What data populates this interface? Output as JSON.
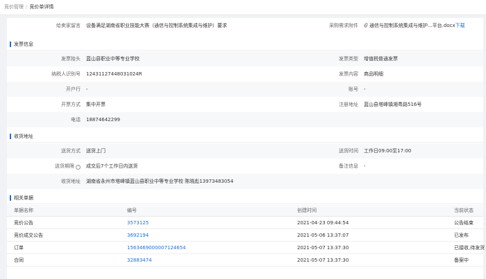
{
  "breadcrumb": {
    "parent": "竞价管理",
    "separator": "/",
    "current": "竞价单详情"
  },
  "top_row": {
    "label1": "给卖家留言",
    "value1": "设备满足湖南省职业技能大赛（通信与控制系统集成与维护）要求",
    "label2": "采购需求附件",
    "attachment_name": "通信与控制系统集成与维护...平台.docx",
    "download_label": "下载"
  },
  "invoice": {
    "title": "发票信息",
    "rows": [
      {
        "label1": "发票抬头",
        "value1": "蓝山县职业中等专业学校",
        "label2": "发票类型",
        "value2": "增值税普通发票"
      },
      {
        "label1": "纳税人识别号",
        "value1": "12431127448031024R",
        "label2": "发票内容",
        "value2": "商品明细"
      },
      {
        "label1": "开户行",
        "value1": "-",
        "label2": "账号",
        "value2": "-"
      },
      {
        "label1": "开票方式",
        "value1": "集中开票",
        "label2": "注册地址",
        "value2": "蓝山县塔峰镇湘粤路516号"
      },
      {
        "label1": "电话",
        "value1": "18874642299"
      }
    ]
  },
  "shipping": {
    "title": "收货地址",
    "rows": [
      {
        "label1": "送货方式",
        "value1": "送货上门",
        "label2": "送货时间",
        "value2": "工作日09:00至17:00"
      },
      {
        "label1": "送货期限",
        "value1": "成交后7个工作日内送货",
        "label2": "备注信息",
        "value2": "-"
      },
      {
        "label1": "收货地址",
        "value1": "湖南省永州市塔峰镇蓝山县职业中等专业学校 陈晓彪13973483054"
      }
    ]
  },
  "related": {
    "title": "相关单据",
    "headers": [
      "单据名称",
      "编号",
      "创建时间",
      "当前状态"
    ],
    "rows": [
      {
        "name": "竞价公告",
        "number": "3573125",
        "created": "2021-04-23 09:44:54",
        "status": "公告结束"
      },
      {
        "name": "竞价成交公告",
        "number": "3692194",
        "created": "2021-05-06 13:37:07",
        "status": "已发布"
      },
      {
        "name": "订单",
        "number": "1563469000007124654",
        "created": "2021-05-07 13:37:30",
        "status": "已接收,待发货"
      },
      {
        "name": "合同",
        "number": "32883474",
        "created": "2021-05-07 13:37:30",
        "status": "备案中"
      }
    ]
  },
  "colors": {
    "accent": "#1e6fd9",
    "label": "#666666",
    "shade": "#f7f8fa"
  },
  "icons": {
    "attachment": "paperclip-icon",
    "help": "question-circle-icon"
  }
}
